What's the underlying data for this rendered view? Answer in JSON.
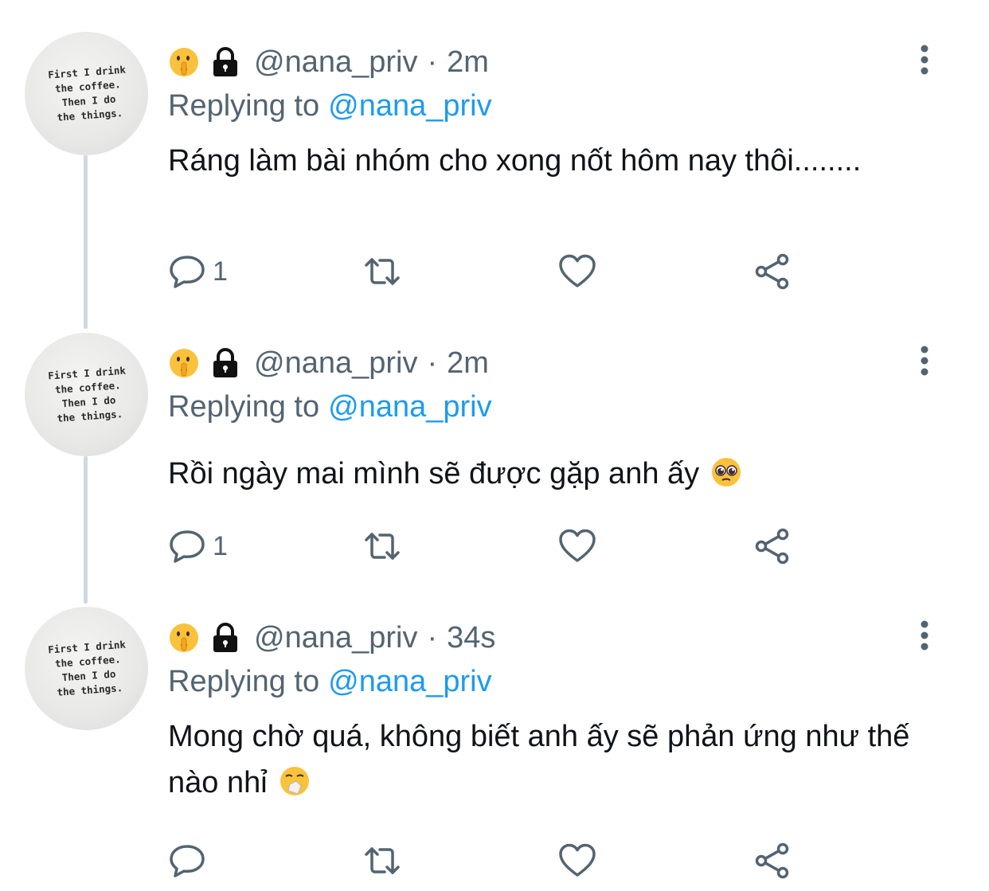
{
  "tweets": [
    {
      "avatar_text": "First I drink\nthe coffee.\nThen I do\nthe things.",
      "handle": "@nana_priv",
      "separator": "·",
      "time": "2m",
      "replying_prefix": "Replying to",
      "replying_to": "@nana_priv",
      "text": "Ráng làm bài nhóm cho xong nốt hôm nay thôi........",
      "emoji": "",
      "reply_count": "1",
      "retweet_count": "",
      "like_count": ""
    },
    {
      "avatar_text": "First I drink\nthe coffee.\nThen I do\nthe things.",
      "handle": "@nana_priv",
      "separator": "·",
      "time": "2m",
      "replying_prefix": "Replying to",
      "replying_to": "@nana_priv",
      "text": "Rồi ngày mai mình sẽ được gặp anh ấy",
      "emoji": "pleading-face",
      "reply_count": "1",
      "retweet_count": "",
      "like_count": ""
    },
    {
      "avatar_text": "First I drink\nthe coffee.\nThen I do\nthe things.",
      "handle": "@nana_priv",
      "separator": "·",
      "time": "34s",
      "replying_prefix": "Replying to",
      "replying_to": "@nana_priv",
      "text": "Mong chờ quá, không biết anh ấy sẽ phản ứng như thế nào nhỉ",
      "emoji": "sneezing-face",
      "reply_count": "",
      "retweet_count": "",
      "like_count": ""
    }
  ],
  "icons": {
    "name_emoji": "shushing-face-icon",
    "lock": "lock-icon",
    "more": "more-vertical-icon",
    "reply": "reply-icon",
    "retweet": "retweet-icon",
    "like": "heart-icon",
    "share": "share-icon"
  },
  "colors": {
    "text": "#0f1419",
    "secondary": "#536471",
    "link": "#1d9bf0",
    "thread_line": "#cfd9de"
  }
}
